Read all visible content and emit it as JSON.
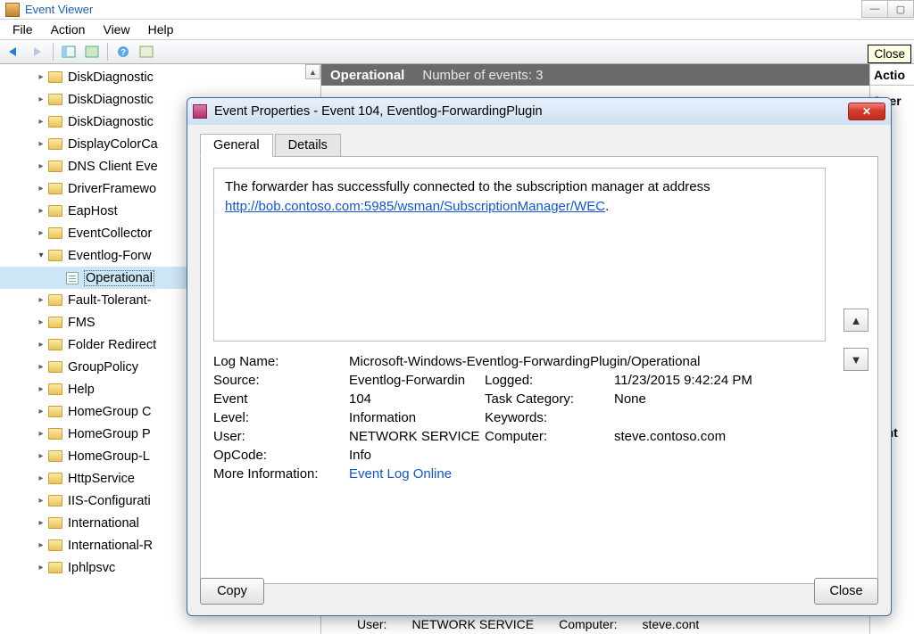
{
  "app": {
    "title": "Event Viewer"
  },
  "menu": {
    "file": "File",
    "action": "Action",
    "view": "View",
    "help": "Help"
  },
  "tree": {
    "items": [
      {
        "label": "DiskDiagnostic",
        "state": "collapsed"
      },
      {
        "label": "DiskDiagnostic",
        "state": "collapsed"
      },
      {
        "label": "DiskDiagnostic",
        "state": "collapsed"
      },
      {
        "label": "DisplayColorCa",
        "state": "collapsed"
      },
      {
        "label": "DNS Client Eve",
        "state": "collapsed"
      },
      {
        "label": "DriverFramewo",
        "state": "collapsed"
      },
      {
        "label": "EapHost",
        "state": "collapsed"
      },
      {
        "label": "EventCollector",
        "state": "collapsed"
      },
      {
        "label": "Eventlog-Forw",
        "state": "expanded"
      },
      {
        "label": "Operational",
        "state": "leaf",
        "selected": true,
        "icon": "log"
      },
      {
        "label": "Fault-Tolerant-",
        "state": "collapsed"
      },
      {
        "label": "FMS",
        "state": "collapsed"
      },
      {
        "label": "Folder Redirect",
        "state": "collapsed"
      },
      {
        "label": "GroupPolicy",
        "state": "collapsed"
      },
      {
        "label": "Help",
        "state": "collapsed"
      },
      {
        "label": "HomeGroup C",
        "state": "collapsed"
      },
      {
        "label": "HomeGroup P",
        "state": "collapsed"
      },
      {
        "label": "HomeGroup-L",
        "state": "collapsed"
      },
      {
        "label": "HttpService",
        "state": "collapsed"
      },
      {
        "label": "IIS-Configurati",
        "state": "collapsed"
      },
      {
        "label": "International",
        "state": "collapsed"
      },
      {
        "label": "International-R",
        "state": "collapsed"
      },
      {
        "label": "Iphlpsvc",
        "state": "collapsed"
      }
    ]
  },
  "center": {
    "title": "Operational",
    "count_label": "Number of events: 3"
  },
  "actions": {
    "header": "Actio",
    "row0": "Oper",
    "row_event": "vent"
  },
  "bottom_peek": {
    "user_lbl": "User:",
    "user_val": "NETWORK SERVICE",
    "computer_lbl": "Computer:",
    "computer_val": "steve.cont"
  },
  "dialog": {
    "title": "Event Properties - Event 104, Eventlog-ForwardingPlugin",
    "tooltip_close": "Close",
    "tabs": {
      "general": "General",
      "details": "Details"
    },
    "description_text": "The forwarder has successfully connected to the subscription manager at address ",
    "description_link": "http://bob.contoso.com:5985/wsman/SubscriptionManager/WEC",
    "fields": {
      "log_name_lbl": "Log Name:",
      "log_name_val": "Microsoft-Windows-Eventlog-ForwardingPlugin/Operational",
      "source_lbl": "Source:",
      "source_val": "Eventlog-Forwardin",
      "logged_lbl": "Logged:",
      "logged_val": "11/23/2015 9:42:24 PM",
      "event_lbl": "Event",
      "event_val": "104",
      "task_lbl": "Task Category:",
      "task_val": "None",
      "level_lbl": "Level:",
      "level_val": "Information",
      "keywords_lbl": "Keywords:",
      "keywords_val": "",
      "user_lbl": "User:",
      "user_val": "NETWORK SERVICE",
      "computer_lbl": "Computer:",
      "computer_val": "steve.contoso.com",
      "opcode_lbl": "OpCode:",
      "opcode_val": "Info",
      "more_lbl": "More Information:",
      "more_link": "Event Log Online"
    },
    "copy_btn": "Copy",
    "close_btn": "Close"
  }
}
